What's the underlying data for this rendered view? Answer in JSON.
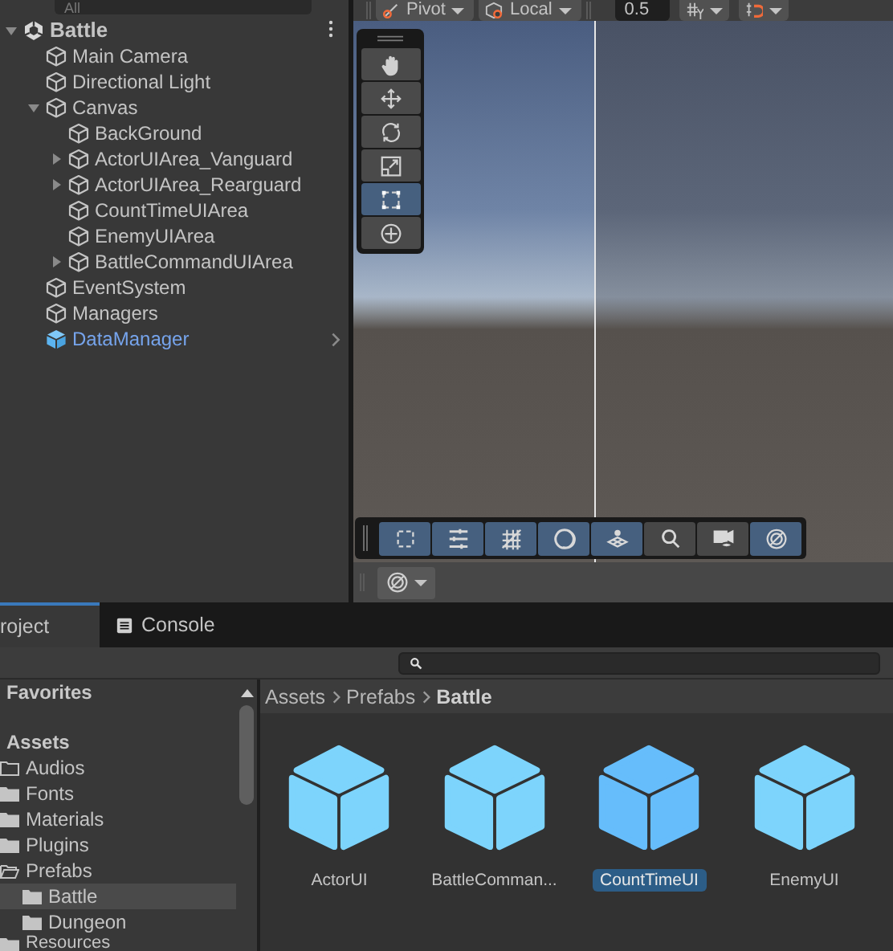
{
  "hierarchy": {
    "search": {
      "placeholder": "All"
    },
    "scene": {
      "name": "Battle",
      "kind": "scene",
      "expanded": true,
      "children": [
        {
          "name": "Main Camera",
          "kind": "object"
        },
        {
          "name": "Directional Light",
          "kind": "object"
        },
        {
          "name": "Canvas",
          "kind": "object",
          "expanded": true,
          "children": [
            {
              "name": "BackGround",
              "kind": "object"
            },
            {
              "name": "ActorUIArea_Vanguard",
              "kind": "object",
              "expanded": false
            },
            {
              "name": "ActorUIArea_Rearguard",
              "kind": "object",
              "expanded": false
            },
            {
              "name": "CountTimeUIArea",
              "kind": "object"
            },
            {
              "name": "EnemyUIArea",
              "kind": "object"
            },
            {
              "name": "BattleCommandUIArea",
              "kind": "object",
              "expanded": false
            }
          ]
        },
        {
          "name": "EventSystem",
          "kind": "object"
        },
        {
          "name": "Managers",
          "kind": "object"
        },
        {
          "name": "DataManager",
          "kind": "prefab"
        }
      ]
    }
  },
  "scene_view": {
    "toolbar": {
      "pivot_mode": "Pivot",
      "handle_space": "Local",
      "snap_increment": "0.5"
    },
    "tools": [
      {
        "kind": "hand",
        "selected": false
      },
      {
        "kind": "move",
        "selected": false
      },
      {
        "kind": "rotate",
        "selected": false
      },
      {
        "kind": "scale",
        "selected": false
      },
      {
        "kind": "rect",
        "selected": true
      },
      {
        "kind": "transform",
        "selected": false
      }
    ],
    "overlay_toolbar": [
      {
        "kind": "rect",
        "on": true
      },
      {
        "kind": "layout",
        "on": true
      },
      {
        "kind": "grid",
        "on": true
      },
      {
        "kind": "shading",
        "on": true
      },
      {
        "kind": "layers",
        "on": true
      },
      {
        "kind": "search",
        "on": false
      },
      {
        "kind": "camera",
        "on": false
      },
      {
        "kind": "gizmo",
        "on": true
      }
    ]
  },
  "project": {
    "tabs": [
      {
        "label": "roject",
        "kind": "project",
        "selected": true
      },
      {
        "label": "Console",
        "kind": "console",
        "selected": false
      }
    ],
    "sidebar": {
      "favorites": "Favorites",
      "root": "Assets",
      "folders": [
        {
          "name": "Audios",
          "empty": true,
          "selected": false
        },
        {
          "name": "Fonts",
          "selected": false
        },
        {
          "name": "Materials",
          "selected": false
        },
        {
          "name": "Plugins",
          "selected": false
        },
        {
          "name": "Prefabs",
          "expanded": true,
          "selected": false,
          "children": [
            {
              "name": "Battle",
              "selected": true
            },
            {
              "name": "Dungeon",
              "selected": false
            }
          ]
        },
        {
          "name": "Resources",
          "selected": false
        }
      ]
    },
    "breadcrumb": [
      "Assets",
      "Prefabs",
      "Battle"
    ],
    "assets": [
      {
        "name": "ActorUI",
        "selected": false
      },
      {
        "name": "BattleComman...",
        "selected": false
      },
      {
        "name": "CountTimeUI",
        "selected": true
      },
      {
        "name": "EnemyUI",
        "selected": false
      }
    ]
  }
}
